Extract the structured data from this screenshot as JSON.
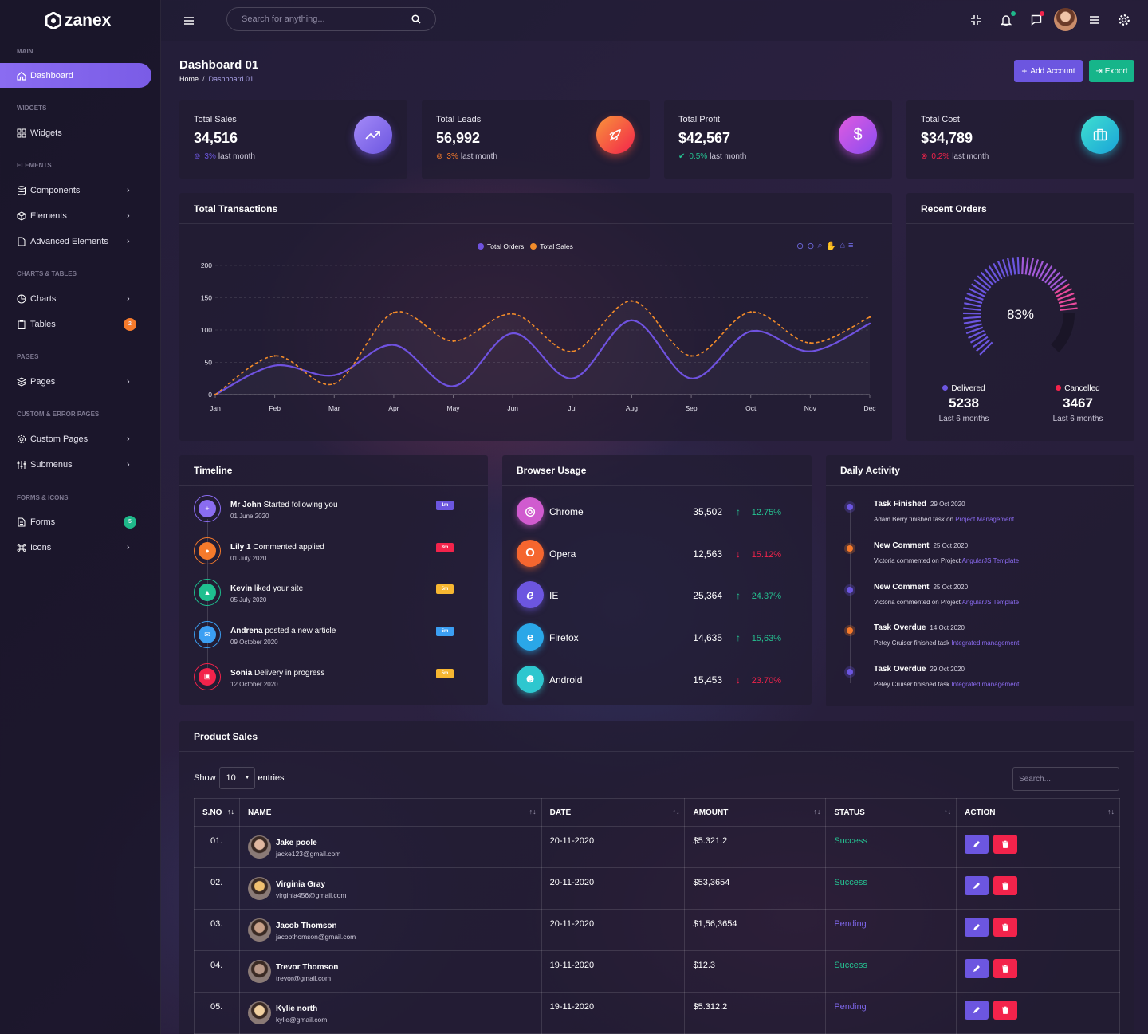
{
  "brand": {
    "name": "zanex"
  },
  "header": {
    "search_placeholder": "Search for anything..."
  },
  "sidebar": {
    "sections": {
      "main": "MAIN",
      "widgets": "WIDGETS",
      "elements": "ELEMENTS",
      "charts": "CHARTS & TABLES",
      "pages": "PAGES",
      "custom": "CUSTOM & ERROR PAGES",
      "forms": "FORMS & ICONS"
    },
    "items": {
      "dashboard": "Dashboard",
      "widgets": "Widgets",
      "components": "Components",
      "elements": "Elements",
      "advanced": "Advanced Elements",
      "charts": "Charts",
      "tables": "Tables",
      "tables_badge": "2",
      "pages": "Pages",
      "custom": "Custom Pages",
      "submenus": "Submenus",
      "forms": "Forms",
      "forms_badge": "5",
      "icons": "Icons"
    }
  },
  "page": {
    "title": "Dashboard 01",
    "crumb_home": "Home",
    "crumb_sep": "/",
    "crumb_current": "Dashboard 01",
    "add_account": "Add Account",
    "export": "Export"
  },
  "stats": [
    {
      "label": "Total Sales",
      "value": "34,516",
      "pct": "3%",
      "sub": "last month",
      "color": "#8a6cf1"
    },
    {
      "label": "Total Leads",
      "value": "56,992",
      "pct": "3%",
      "sub": "last month",
      "color": "#f57a2b"
    },
    {
      "label": "Total Profit",
      "value": "$42,567",
      "pct": "0.5%",
      "sub": "last month",
      "color": "#25c291"
    },
    {
      "label": "Total Cost",
      "value": "$34,789",
      "pct": "0.2%",
      "sub": "last month",
      "color": "#f3234b"
    }
  ],
  "transactions": {
    "title": "Total Transactions"
  },
  "chart_data": {
    "type": "line",
    "x": [
      "Jan",
      "Feb",
      "Mar",
      "Apr",
      "May",
      "Jun",
      "Jul",
      "Aug",
      "Sep",
      "Oct",
      "Nov",
      "Dec"
    ],
    "series": [
      {
        "name": "Total Orders",
        "color": "#6f52df",
        "values": [
          0,
          45,
          30,
          77,
          13,
          95,
          25,
          115,
          25,
          98,
          67,
          110
        ]
      },
      {
        "name": "Total Sales",
        "color": "#f28b2a",
        "values": [
          0,
          60,
          17,
          127,
          83,
          125,
          67,
          145,
          60,
          128,
          80,
          120
        ]
      }
    ],
    "yticks": [
      "0",
      "50",
      "100",
      "150",
      "200"
    ],
    "ylim": [
      0,
      200
    ]
  },
  "orders": {
    "title": "Recent Orders",
    "percent": 83,
    "percent_label": "83%",
    "delivered_label": "Delivered",
    "delivered_value": "5238",
    "delivered_sub": "Last 6 months",
    "cancelled_label": "Cancelled",
    "cancelled_value": "3467",
    "cancelled_sub": "Last 6 months"
  },
  "timeline": {
    "title": "Timeline",
    "items": [
      {
        "name": "Mr John",
        "action": " Started following you",
        "date": "01 June 2020",
        "badge": "1m",
        "color": "#8a6cf1",
        "badge_color": "#6c56e0"
      },
      {
        "name": "Lily 1",
        "action": " Commented applied",
        "date": "01 July 2020",
        "badge": "3m",
        "color": "#f57a2b",
        "badge_color": "#f3234b"
      },
      {
        "name": "Kevin",
        "action": " liked your site",
        "date": "05 July 2020",
        "badge": "5m",
        "color": "#1fbf8f",
        "badge_color": "#f7b731"
      },
      {
        "name": "Andrena",
        "action": " posted a new article",
        "date": "09 October 2020",
        "badge": "5m",
        "color": "#3b9ff3",
        "badge_color": "#3b9ff3"
      },
      {
        "name": "Sonia",
        "action": " Delivery in progress",
        "date": "12 October 2020",
        "badge": "5m",
        "color": "#f3234b",
        "badge_color": "#f7b731"
      }
    ]
  },
  "browser": {
    "title": "Browser Usage",
    "items": [
      {
        "name": "Chrome",
        "value": "35,502",
        "pct": "12.75%",
        "up": true,
        "color": "#d05bcf"
      },
      {
        "name": "Opera",
        "value": "12,563",
        "pct": "15.12%",
        "up": false,
        "color": "#f5662f"
      },
      {
        "name": "IE",
        "value": "25,364",
        "pct": "24.37%",
        "up": true,
        "color": "#6c56e0"
      },
      {
        "name": "Firefox",
        "value": "14,635",
        "pct": "15,63%",
        "up": true,
        "color": "#2aa7e8"
      },
      {
        "name": "Android",
        "value": "15,453",
        "pct": "23.70%",
        "up": false,
        "color": "#2ec7cf"
      }
    ]
  },
  "activity": {
    "title": "Daily Activity",
    "items": [
      {
        "title": "Task Finished",
        "date": "29 Oct 2020",
        "desc": "Adam Berry finished task on ",
        "link": "Project Management",
        "color": "#6c56e0"
      },
      {
        "title": "New Comment",
        "date": "25 Oct 2020",
        "desc": "Victoria commented on Project ",
        "link": "AngularJS Template",
        "color": "#f57a2b"
      },
      {
        "title": "New Comment",
        "date": "25 Oct 2020",
        "desc": "Victoria commented on Project ",
        "link": "AngularJS Template",
        "color": "#6c56e0"
      },
      {
        "title": "Task Overdue",
        "date": "14 Oct 2020",
        "desc": "Petey Cruiser finished task ",
        "link": "Integrated management",
        "color": "#f57a2b"
      },
      {
        "title": "Task Overdue",
        "date": "29 Oct 2020",
        "desc": "Petey Cruiser finished task ",
        "link": "Integrated management",
        "color": "#6c56e0"
      }
    ]
  },
  "product": {
    "title": "Product Sales",
    "show": "Show",
    "entries_value": "10",
    "entries": "entries",
    "search_placeholder": "Search...",
    "columns": [
      "S.NO",
      "NAME",
      "DATE",
      "AMOUNT",
      "STATUS",
      "ACTION"
    ],
    "rows": [
      {
        "sno": "01.",
        "name": "Jake poole",
        "email": "jacke123@gmail.com",
        "date": "20-11-2020",
        "amount": "$5.321.2",
        "status": "Success"
      },
      {
        "sno": "02.",
        "name": "Virginia Gray",
        "email": "virginia456@gmail.com",
        "date": "20-11-2020",
        "amount": "$53,3654",
        "status": "Success"
      },
      {
        "sno": "03.",
        "name": "Jacob Thomson",
        "email": "jacobthomson@gmail.com",
        "date": "20-11-2020",
        "amount": "$1,56,3654",
        "status": "Pending"
      },
      {
        "sno": "04.",
        "name": "Trevor Thomson",
        "email": "trevor@gmail.com",
        "date": "19-11-2020",
        "amount": "$12.3",
        "status": "Success"
      },
      {
        "sno": "05.",
        "name": "Kylie north",
        "email": "kylie@gmail.com",
        "date": "19-11-2020",
        "amount": "$5.312.2",
        "status": "Pending"
      }
    ]
  },
  "colors": {
    "accent": "#8a6cf1",
    "success": "#25c291",
    "pending": "#7d66e8",
    "danger": "#f3234b",
    "edit": "#6c56e0"
  }
}
